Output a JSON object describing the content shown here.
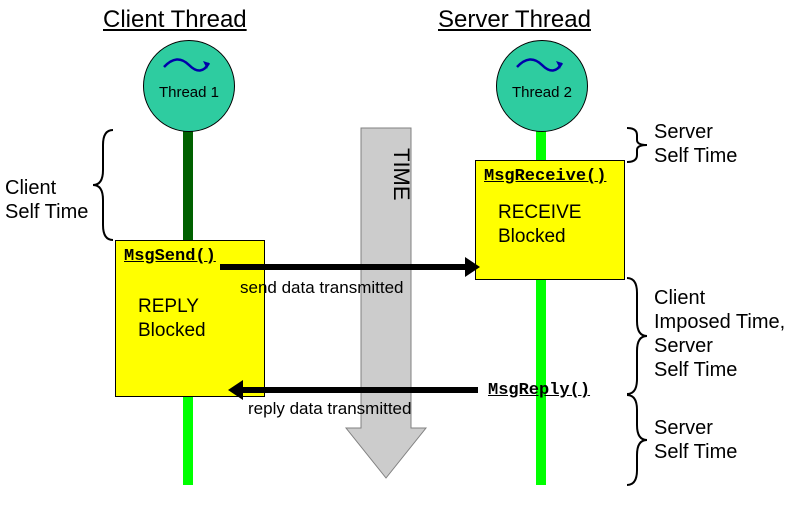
{
  "titles": {
    "client": "Client Thread",
    "server": "Server Thread"
  },
  "threads": {
    "t1": "Thread 1",
    "t2": "Thread 2"
  },
  "time_label": "TIME",
  "client_box": {
    "api": "MsgSend()",
    "state1": "REPLY",
    "state2": "Blocked"
  },
  "server_box": {
    "api": "MsgReceive()",
    "state1": "RECEIVE",
    "state2": "Blocked"
  },
  "reply_api": "MsgReply()",
  "messages": {
    "send": "send data transmitted",
    "reply": "reply data transmitted"
  },
  "labels": {
    "client_self": "Client\nSelf Time",
    "server_self_top": "Server\nSelf Time",
    "client_imposed": "Client\nImposed Time,\nServer\nSelf Time",
    "server_self_bottom": "Server\nSelf Time"
  },
  "colors": {
    "box": "#ffff00",
    "circle": "#2ecca0",
    "dark_line": "#006000",
    "light_line": "#00ff00",
    "time_arrow": "#cccccc"
  }
}
